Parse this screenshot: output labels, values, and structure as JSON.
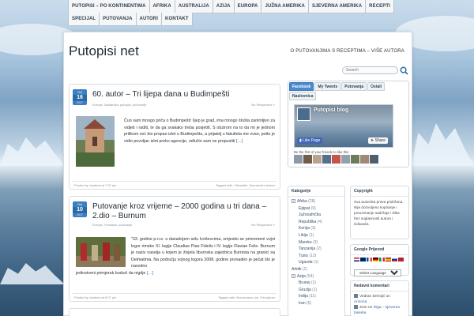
{
  "nav": {
    "row1": [
      "PUTOPISI – PO KONTINENTIMA",
      "AFRIKA",
      "AUSTRALIJA",
      "AZIJA",
      "EUROPA",
      "JUŽNA AMERIKA",
      "SJEVERNA AMERIKA",
      "RECEPTI"
    ],
    "row2": [
      "SPECIJAL",
      "PUTOVANJA",
      "AUTORI",
      "KONTAKT"
    ]
  },
  "site": {
    "title": "Putopisi net",
    "description": "O PUTOVANJIMA S RECEPTIMA – VIŠE AUTORA",
    "search_placeholder": "Search"
  },
  "posts": [
    {
      "date_month": "Oct",
      "date_day": "16",
      "date_year": "2017",
      "title": "60. autor – Tri lijepa dana u Budimpešti",
      "categories": "Europe, Mađarska, putopisi, putovanje",
      "comments": "No Responses »",
      "excerpt": "Čuo sam mnogo priča o Budimpešti: lijep je grad, ima mnogo štošta zanimljivo za vidjeti i raditi, te da ga svakako treba posjetiti. S obzirom na to da mi je jednom prilikom već bio propao izlet u Budimpeštu, a prijatelj s fakulteta me zvao, potto je vidio povoljan izlet preko agencije, odlučio sam ne propustiti ",
      "more": "[…]",
      "author": "Posted by: kostiesi at 7:32 pm",
      "tags": "Tagged with: Cittadelle, Szentendri skoloci"
    },
    {
      "date_month": "Oct",
      "date_day": "10",
      "date_year": "2017",
      "title": "Putovanje kroz vrijeme – 2000 godina u tri dana – 2.dio – Burnum",
      "categories": "Europe, Hrvatska, putovanje",
      "comments": "No Responses »",
      "excerpt": "\"33. godine p.n.e. u današnjem selu Ivoševcima, smjestio se privremeni vojni logor rimske XI. legije Claudiae Piae Fidelis i IV. legije Flaviae Felix. Burnum je naziv naselja u kojem je živjela liburnska zajednica Burnista na granici sa Delmatima. Na području vojnog logora 2008. godine pronađen je pečat što je navodno",
      "excerpt_wide": "jedinstveni primjerak budući da nigdje ",
      "more": "[…]",
      "author": "Posted by: kostiesi at 6:07 pm",
      "tags": "Tagged with: Burnumska, luk, Principium"
    }
  ],
  "sidebar": {
    "tabs": [
      "Facebook",
      "My Tweets",
      "Putovanja",
      "Ostali",
      "Naslovnica"
    ],
    "facebook": {
      "page_name": "Putopisi blog",
      "like_label": "Like Page",
      "share_label": "Share",
      "friends_text": "Be the first of your friends to like this"
    },
    "categories": {
      "title": "Kategorije",
      "items": [
        {
          "label": "Afrika",
          "count": "(28)",
          "level": 0,
          "expand": "+"
        },
        {
          "label": "Egipat",
          "count": "(9)",
          "level": 1
        },
        {
          "label": "Južnoafrička",
          "count": "",
          "level": 1
        },
        {
          "label": "Republika",
          "count": "(4)",
          "level": 1
        },
        {
          "label": "Kenija",
          "count": "(3)",
          "level": 1
        },
        {
          "label": "Libija",
          "count": "(1)",
          "level": 1
        },
        {
          "label": "Maroko",
          "count": "(3)",
          "level": 1
        },
        {
          "label": "Tanzanija",
          "count": "(2)",
          "level": 1
        },
        {
          "label": "Tunis",
          "count": "(12)",
          "level": 1
        },
        {
          "label": "Uganda",
          "count": "(1)",
          "level": 1
        },
        {
          "label": "Arktik",
          "count": "(1)",
          "level": 0
        },
        {
          "label": "Azija",
          "count": "(54)",
          "level": 0,
          "expand": "+"
        },
        {
          "label": "Brunej",
          "count": "(1)",
          "level": 1
        },
        {
          "label": "Gruzija",
          "count": "(1)",
          "level": 1
        },
        {
          "label": "Indija",
          "count": "(11)",
          "level": 1
        },
        {
          "label": "Iran",
          "count": "(6)",
          "level": 1
        }
      ]
    },
    "copyright": {
      "title": "Copyright",
      "text": "Sva autorska prava pridržana. Nije dozvoljeno kopiranje i preuzimanje sadržaja i slika bez suglasnosti autora i izdavača."
    },
    "translate": {
      "title": "Google Prijevod",
      "select_label": "Select Language"
    },
    "recent_comments": {
      "title": "Nedavni komentari",
      "items": [
        {
          "who": "Vedran Demijić on",
          "what": "Arizona"
        },
        {
          "who": "Zum on",
          "what": "Riga – sjeverna biserka"
        }
      ]
    }
  },
  "colors": {
    "accent": "#4a8bd0",
    "badge": "#2b6aa6",
    "link": "#3266a8"
  }
}
